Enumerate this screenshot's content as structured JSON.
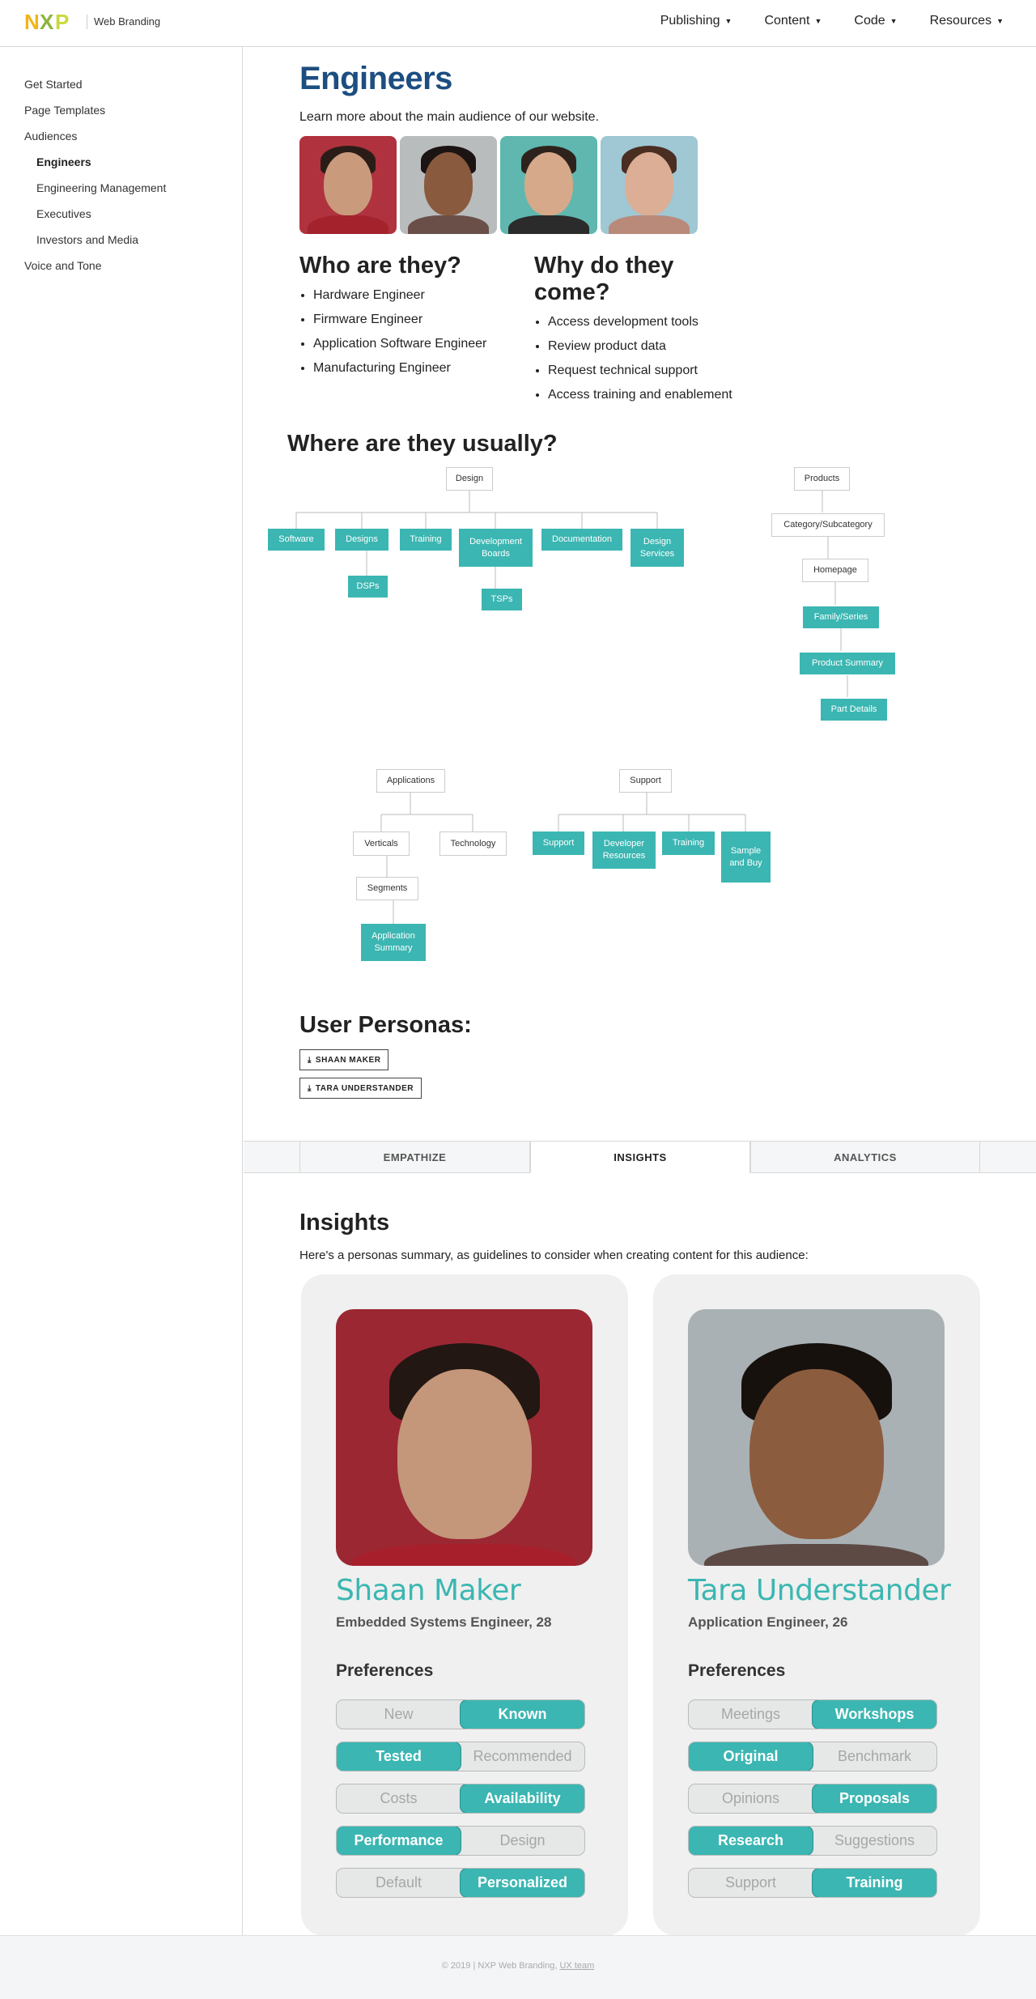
{
  "header": {
    "logo_text": "NXP",
    "site_name": "Web Branding",
    "nav": [
      "Publishing",
      "Content",
      "Code",
      "Resources"
    ]
  },
  "sidebar": {
    "items": [
      "Get Started",
      "Page Templates",
      "Audiences",
      "Engineers",
      "Engineering Management",
      "Executives",
      "Investors and Media",
      "Voice and Tone"
    ]
  },
  "main": {
    "title": "Engineers",
    "intro": "Learn more about the main audience of our website.",
    "who_title": "Who are they?",
    "who_items": [
      "Hardware Engineer",
      "Firmware Engineer",
      "Application Software Engineer",
      "Manufacturing Engineer"
    ],
    "why_title": "Why do they come?",
    "why_items": [
      "Access development tools",
      "Review product data",
      "Request technical support",
      "Access training and enablement"
    ],
    "where_title": "Where are they usually?"
  },
  "diagram": {
    "design": "Design",
    "software": "Software",
    "designs": "Designs",
    "training": "Training",
    "dev_boards": "Development Boards",
    "documentation": "Documentation",
    "design_services": "Design Services",
    "dsps": "DSPs",
    "tsps": "TSPs",
    "products": "Products",
    "category": "Category/Subcategory",
    "homepage": "Homepage",
    "family": "Family/Series",
    "product_summary": "Product Summary",
    "part_details": "Part Details",
    "applications": "Applications",
    "verticals": "Verticals",
    "technology": "Technology",
    "segments": "Segments",
    "app_summary": "Application Summary",
    "support_root": "Support",
    "support": "Support",
    "dev_resources": "Developer Resources",
    "training2": "Training",
    "sample_buy": "Sample and Buy"
  },
  "personas": {
    "title": "User Personas:",
    "downloads": [
      "SHAAN MAKER",
      "TARA UNDERSTANDER"
    ]
  },
  "tabs": [
    "EMPATHIZE",
    "INSIGHTS",
    "ANALYTICS"
  ],
  "insights": {
    "title": "Insights",
    "text": "Here's a personas summary, as guidelines to consider when creating content for this audience:",
    "cards": [
      {
        "name": "Shaan Maker",
        "role": "Embedded Systems Engineer, 28",
        "pref_title": "Preferences",
        "prefs": [
          [
            "New",
            "Known"
          ],
          [
            "Tested",
            "Recommended"
          ],
          [
            "Costs",
            "Availability"
          ],
          [
            "Performance",
            "Design"
          ],
          [
            "Default",
            "Personalized"
          ]
        ],
        "selected": [
          1,
          0,
          1,
          0,
          1
        ]
      },
      {
        "name": "Tara Understander",
        "role": "Application Engineer, 26",
        "pref_title": "Preferences",
        "prefs": [
          [
            "Meetings",
            "Workshops"
          ],
          [
            "Original",
            "Benchmark"
          ],
          [
            "Opinions",
            "Proposals"
          ],
          [
            "Research",
            "Suggestions"
          ],
          [
            "Support",
            "Training"
          ]
        ],
        "selected": [
          1,
          0,
          1,
          0,
          1
        ]
      }
    ]
  },
  "footer": {
    "text": "© 2019 | NXP Web Branding, ",
    "link": "UX team"
  },
  "colors": {
    "title_blue": "#1c4e80",
    "teal": "#3bb6b2",
    "logo_yellow": "#f2b417",
    "logo_green": "#b5d33b"
  }
}
